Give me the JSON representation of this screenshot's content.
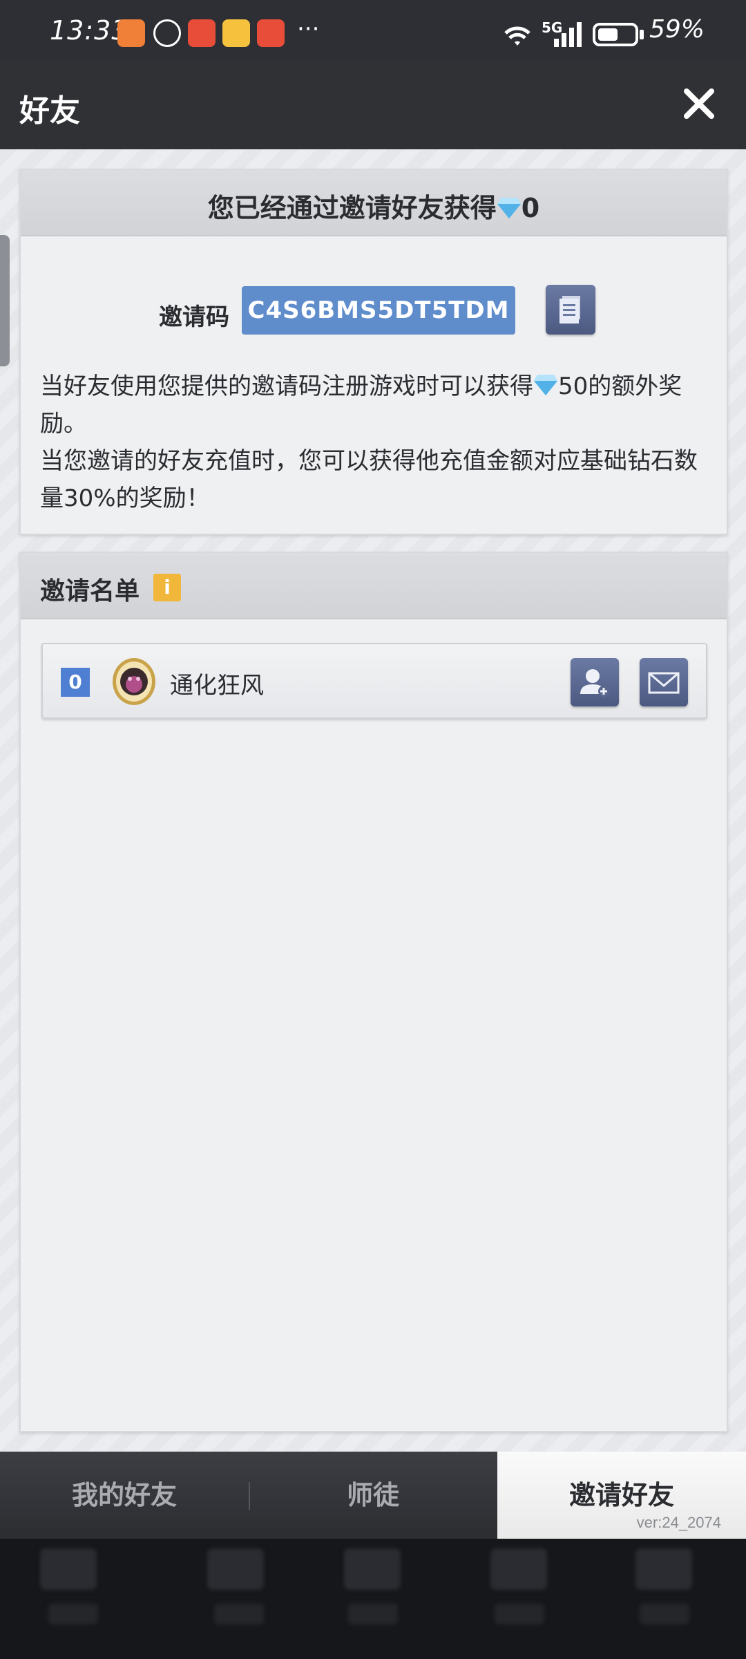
{
  "status_bar": {
    "time": "13:33",
    "more": "···",
    "network": "5G",
    "battery": "59%"
  },
  "header": {
    "title": "好友"
  },
  "invite_panel": {
    "title_prefix": "您已经通过邀请好友获得",
    "title_value": "0",
    "code_label": "邀请码",
    "code_value": "C4S6BMS5DT5TDM",
    "desc_part1": "当好友使用您提供的邀请码注册游戏时可以获得",
    "desc_reward": "50",
    "desc_part2": "的额外奖励。",
    "desc_line2": "当您邀请的好友充值时，您可以获得他充值金额对应基础钻石数量30%的奖励！"
  },
  "invite_list": {
    "title": "邀请名单",
    "info_icon": "i",
    "rows": [
      {
        "rank": "0",
        "name": "通化狂风"
      }
    ]
  },
  "tabs": [
    {
      "label": "我的好友"
    },
    {
      "label": "师徒"
    },
    {
      "label": "邀请好友"
    }
  ],
  "version": "ver:24_2074",
  "colors": {
    "accent_blue": "#5f8dcc",
    "button_slate": "#5a6890",
    "badge_yellow": "#f1b73a"
  }
}
